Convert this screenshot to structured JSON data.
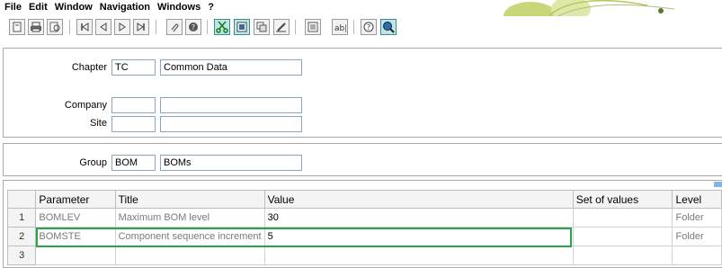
{
  "menu": {
    "items": [
      {
        "label": "File"
      },
      {
        "label": "Edit"
      },
      {
        "label": "Window"
      },
      {
        "label": "Navigation"
      },
      {
        "label": "Windows"
      },
      {
        "label": "?"
      }
    ]
  },
  "toolbar": {
    "buttons": [
      {
        "icon": "new-doc-icon"
      },
      {
        "icon": "print-icon"
      },
      {
        "icon": "print-preview-icon"
      },
      {
        "icon": "first-record-icon"
      },
      {
        "icon": "previous-record-icon"
      },
      {
        "icon": "next-record-icon"
      },
      {
        "icon": "last-record-icon"
      },
      {
        "icon": "attachment-icon"
      },
      {
        "icon": "help-circle-icon"
      },
      {
        "icon": "scissors-icon"
      },
      {
        "icon": "window-restore-icon"
      },
      {
        "icon": "window-copy-icon"
      },
      {
        "icon": "edit-pencil-icon"
      },
      {
        "icon": "list-icon"
      },
      {
        "icon": "ab-text-icon"
      },
      {
        "icon": "question-icon"
      },
      {
        "icon": "search-globe-icon"
      }
    ],
    "accent": "#3c8c8c"
  },
  "form": {
    "chapter_label": "Chapter",
    "chapter_code": "TC",
    "chapter_desc": "Common Data",
    "company_label": "Company",
    "company_code": "",
    "company_desc": "",
    "site_label": "Site",
    "site_code": "",
    "site_desc": "",
    "group_label": "Group",
    "group_code": "BOM",
    "group_desc": "BOMs"
  },
  "grid": {
    "columns": [
      "Parameter",
      "Title",
      "Value",
      "Set of values",
      "Level"
    ],
    "rows": [
      {
        "num": "1",
        "parameter": "BOMLEV",
        "title": "Maximum BOM level",
        "value": "30",
        "set": "",
        "level": "Folder"
      },
      {
        "num": "2",
        "parameter": "BOMSTE",
        "title": "Component sequence increment",
        "value": "5",
        "set": "",
        "level": "Folder"
      },
      {
        "num": "3",
        "parameter": "",
        "title": "",
        "value": "",
        "set": "",
        "level": ""
      }
    ],
    "selection_color": "#27a34a"
  }
}
